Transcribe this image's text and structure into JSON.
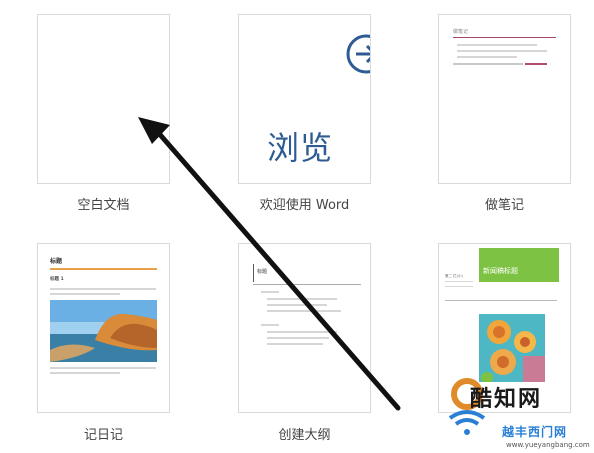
{
  "templates": [
    {
      "label": "空白文档"
    },
    {
      "label": "欢迎使用 Word",
      "preview_text": "浏览"
    },
    {
      "label": "做笔记",
      "preview_title": "做笔记"
    },
    {
      "label": "记日记",
      "preview_title": "标题",
      "preview_subtitle": "标题 1"
    },
    {
      "label": "创建大纲",
      "preview_title": "标题"
    },
    {
      "label": "",
      "preview_title": "新闻稿标题",
      "preview_side": "第二 栏(小)"
    }
  ],
  "watermark": {
    "main": "酷知网",
    "sub": "越丰西门网",
    "url": "www.yueyangbang.com"
  },
  "colors": {
    "browse_blue": "#2e5b93",
    "note_accent": "#a34a6b",
    "diary_accent": "#e8a148",
    "news_green": "#7dc242"
  },
  "icons": [
    "arrow-right-circle-icon",
    "pointer-arrow-icon",
    "watermark-logo-icon"
  ]
}
